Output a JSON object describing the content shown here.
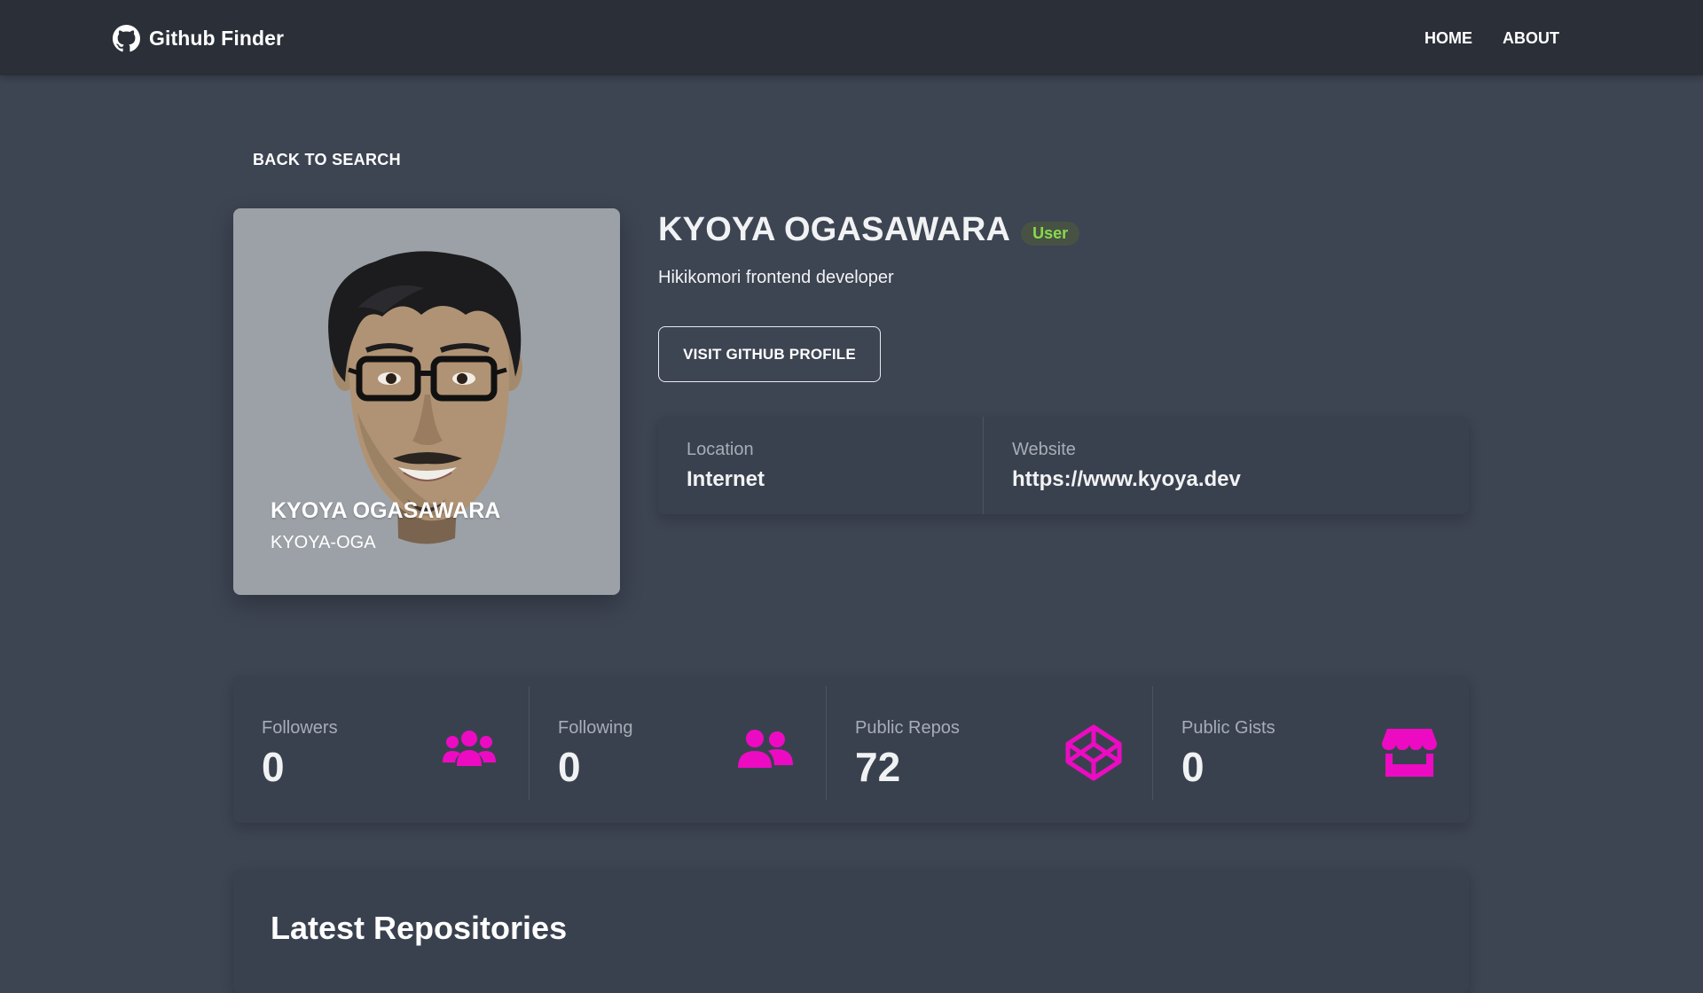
{
  "nav": {
    "brand": "Github Finder",
    "brand_icon": "github-icon",
    "links": [
      "HOME",
      "ABOUT"
    ]
  },
  "back_label": "BACK TO SEARCH",
  "avatar": {
    "name": "KYOYA OGASAWARA",
    "login": "KYOYA-OGA"
  },
  "profile": {
    "name": "KYOYA OGASAWARA",
    "type_badge": "User",
    "bio": "Hikikomori frontend developer",
    "visit_label": "VISIT GITHUB PROFILE"
  },
  "info": {
    "location_label": "Location",
    "location_value": "Internet",
    "website_label": "Website",
    "website_value": "https://www.kyoya.dev"
  },
  "stats": [
    {
      "label": "Followers",
      "value": "0",
      "icon": "users-icon"
    },
    {
      "label": "Following",
      "value": "0",
      "icon": "user-friends-icon"
    },
    {
      "label": "Public Repos",
      "value": "72",
      "icon": "codepen-icon"
    },
    {
      "label": "Public Gists",
      "value": "0",
      "icon": "store-icon"
    }
  ],
  "repos": {
    "title": "Latest Repositories"
  },
  "colors": {
    "accent": "#ec0bc3",
    "badge_text": "#8ad94c",
    "navbar": "#2a2f38",
    "background": "#3d4452"
  }
}
